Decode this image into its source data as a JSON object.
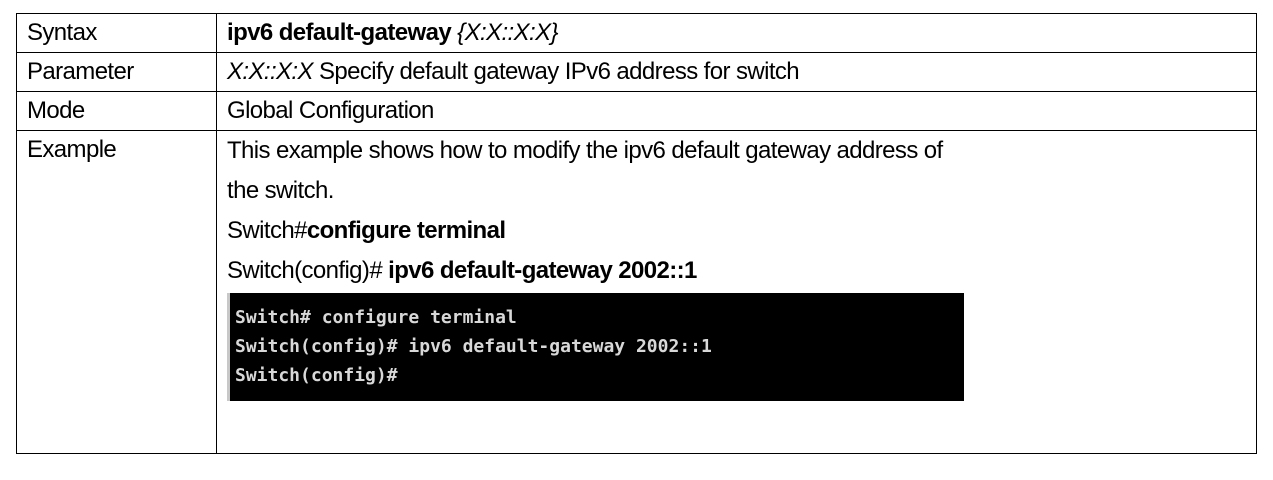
{
  "rows": {
    "syntax": {
      "label": "Syntax",
      "command": "ipv6 default-gateway",
      "argument": "{X:X::X:X}"
    },
    "parameter": {
      "label": "Parameter",
      "name": "X:X::X:X",
      "description": "Specify default gateway IPv6 address for switch"
    },
    "mode": {
      "label": "Mode",
      "value": "Global Configuration"
    },
    "example": {
      "label": "Example",
      "description_line1": "This example shows how to modify the ipv6 default gateway address of",
      "description_line2": "the switch.",
      "step1_prompt": "Switch#",
      "step1_command": "configure terminal",
      "step2_prompt": "Switch(config)# ",
      "step2_command": "ipv6 default-gateway 2002::1"
    }
  },
  "terminal": {
    "lines": [
      "Switch# configure terminal",
      "Switch(config)# ipv6 default-gateway 2002::1",
      "Switch(config)#"
    ]
  }
}
